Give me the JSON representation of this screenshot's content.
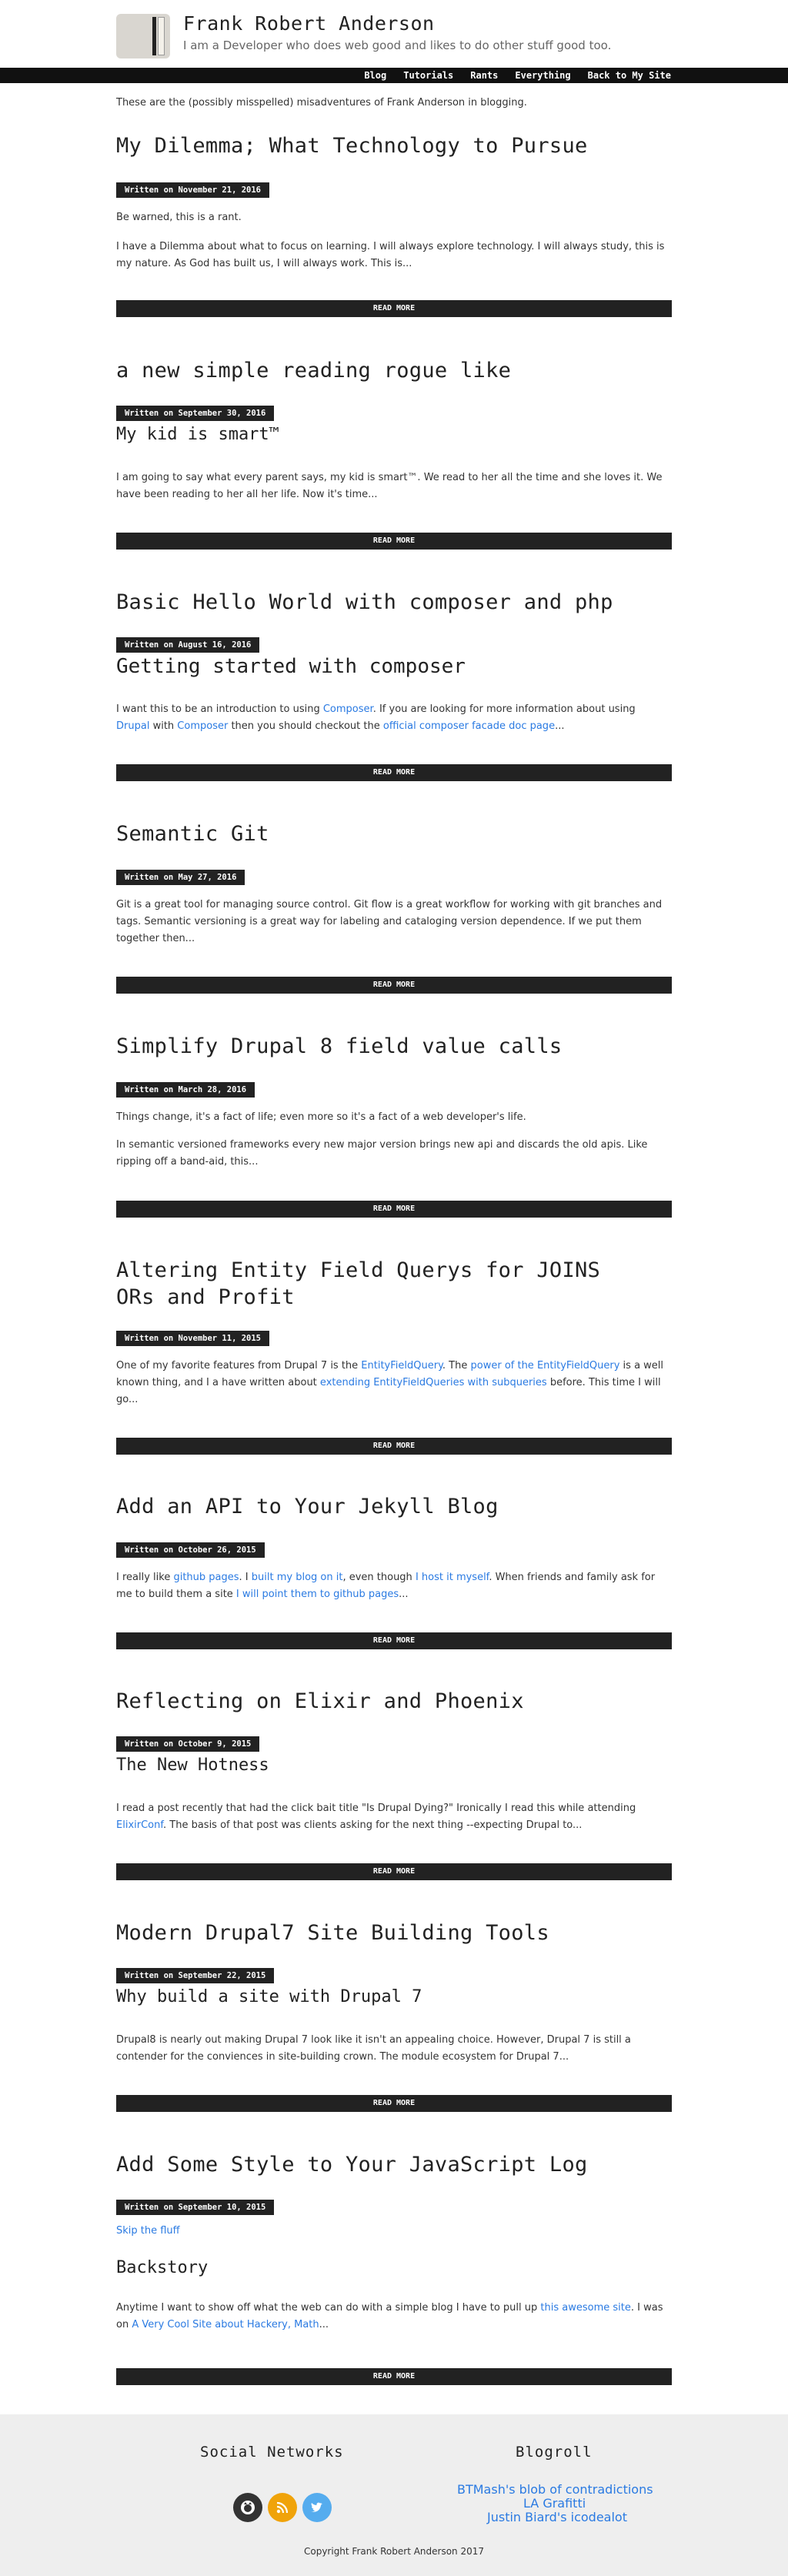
{
  "site": {
    "title": "Frank Robert Anderson",
    "description": "I am a Developer who does web good and likes to do other stuff good too."
  },
  "nav": [
    "Blog",
    "Tutorials",
    "Rants",
    "Everything",
    "Back to My Site"
  ],
  "intro": "These are the (possibly misspelled) misadventures of Frank Anderson in blogging.",
  "read_more": "READ MORE",
  "posts": [
    {
      "title": "My Dilemma; What Technology to Pursue",
      "date": "Written on November 21, 2016",
      "p1": "Be warned, this is a rant.",
      "p2": "I have a Dilemma about what to focus on learning. I will always explore technology. I will always study, this is my nature. As God has built us, I will always work. This is..."
    },
    {
      "title": "a new simple reading rogue like",
      "date": "Written on September 30, 2016",
      "subtitle": "My kid is smart™",
      "p1": "I am going to say what every parent says, my kid is smart™. We read to her all the time and she loves it. We have been reading to her all her life. Now it's time..."
    },
    {
      "title": "Basic Hello World with composer and php",
      "date": "Written on August 16, 2016",
      "subtitle": "Getting started with composer",
      "t1": "I want this to be an introduction to using ",
      "l1": "Composer",
      "t2": ". If you are looking for more information about using ",
      "l2": "Drupal",
      "t3": " with ",
      "l3": "Composer",
      "t4": " then you should checkout the ",
      "l4": "official composer facade doc page",
      "t5": "..."
    },
    {
      "title": "Semantic Git",
      "date": "Written on May 27, 2016",
      "p1": "Git is a great tool for managing source control. Git flow is a great workflow for working with git branches and tags. Semantic versioning is a great way for labeling and cataloging version dependence. If we put them together then..."
    },
    {
      "title": "Simplify Drupal 8 field value calls",
      "date": "Written on March 28, 2016",
      "p1": "Things change, it's a fact of life; even more so it's a fact of a web developer's life.",
      "p2": "In semantic versioned frameworks every new major version brings new api and discards the old apis. Like ripping off a band-aid, this..."
    },
    {
      "title_l1": "Altering Entity Field Querys for JOINS",
      "title_l2": "ORs and Profit",
      "date": "Written on November 11, 2015",
      "t1": "One of my favorite features from Drupal 7 is the ",
      "l1": "EntityFieldQuery",
      "t2": ". The ",
      "l2": "power of the EntityFieldQuery",
      "t3": " is a well known thing, and I a have written about ",
      "l3": "extending EntityFieldQueries with subqueries",
      "t4": " before. This time I will go..."
    },
    {
      "title": "Add an API to Your Jekyll Blog",
      "date": "Written on October 26, 2015",
      "t1": "I really like ",
      "l1": "github pages",
      "t2": ". I ",
      "l2": "built my blog on it",
      "t3": ", even though ",
      "l3": "I host it myself",
      "t4": ". When friends and family ask for me to build them a site ",
      "l4": "I will point them to github pages",
      "t5": "..."
    },
    {
      "title": "Reflecting on Elixir and Phoenix",
      "date": "Written on October 9, 2015",
      "subtitle": "The New Hotness",
      "t1": "I read a post recently that had the click bait title \"Is Drupal Dying?\" Ironically I read this while attending ",
      "l1": "ElixirConf",
      "t2": ". The basis of that post was clients asking for the next thing --expecting Drupal to..."
    },
    {
      "title": "Modern Drupal7 Site Building Tools",
      "date": "Written on September 22, 2015",
      "subtitle": "Why build a site with Drupal 7",
      "p1": "Drupal8 is nearly out making Drupal 7 look like it isn't an appealing choice. However, Drupal 7 is still a contender for the conviences in site-building crown. The module ecosystem for Drupal 7..."
    },
    {
      "title": "Add Some Style to Your JavaScript Log",
      "date": "Written on September 10, 2015",
      "skip": "Skip the fluff",
      "subtitle": "Backstory",
      "t1": "Anytime I want to show off what the web can do with a simple blog I have to pull up ",
      "l1": "this awesome site",
      "t2": ". I was on ",
      "l2": "A Very Cool Site about Hackery, Math",
      "t3": "..."
    }
  ],
  "footer": {
    "social_heading": "Social Networks",
    "blogroll_heading": "Blogroll",
    "blogroll": [
      "BTMash's blob of contradictions",
      "LA Grafitti",
      "Justin Biard's icodealot"
    ],
    "copyright": "Copyright Frank Robert Anderson 2017",
    "colors": {
      "github": "#333333",
      "rss": "#f0a30a",
      "twitter": "#55acee"
    }
  }
}
